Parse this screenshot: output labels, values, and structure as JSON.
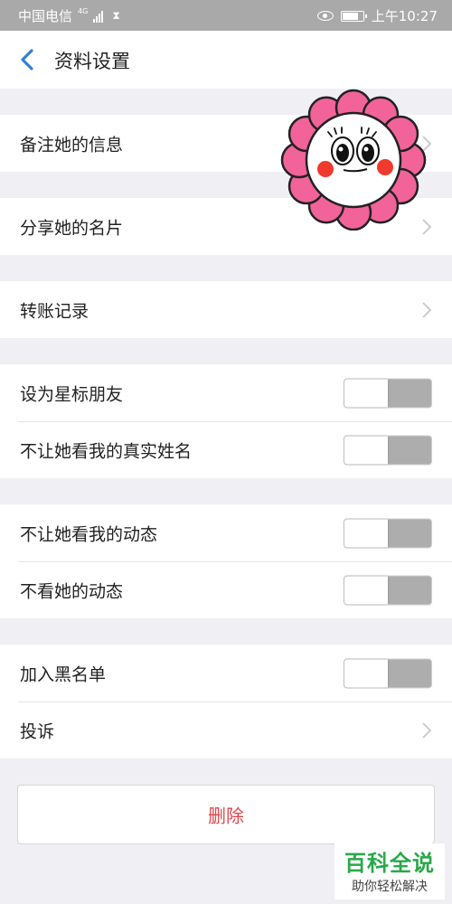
{
  "status_bar": {
    "carrier": "中国电信",
    "network": "4G",
    "time": "上午10:27",
    "battery_level": 0.8,
    "icons": [
      "signal-icon",
      "hourglass-icon",
      "eye-icon",
      "battery-icon"
    ]
  },
  "header": {
    "title": "资料设置",
    "back_icon": "chevron-left-icon"
  },
  "settings": {
    "remark": {
      "label": "备注她的信息"
    },
    "share_card": {
      "label": "分享她的名片"
    },
    "transfer_records": {
      "label": "转账记录"
    },
    "star_friend": {
      "label": "设为星标朋友",
      "enabled": false
    },
    "hide_real_name": {
      "label": "不让她看我的真实姓名",
      "enabled": false
    },
    "hide_my_moments": {
      "label": "不让她看我的动态",
      "enabled": false
    },
    "hide_her_moments": {
      "label": "不看她的动态",
      "enabled": false
    },
    "blacklist": {
      "label": "加入黑名单",
      "enabled": false
    },
    "report": {
      "label": "投诉"
    }
  },
  "delete_button": {
    "label": "删除"
  },
  "sticker": {
    "icon": "flower-face-sticker"
  },
  "watermark": {
    "title": "百科全说",
    "subtitle": "助你轻松解决"
  },
  "colors": {
    "accent": "#2f82d6",
    "danger": "#e0464d",
    "toggle_off": "#adadad",
    "status_bar": "#a9a9a9",
    "background": "#efeff4",
    "watermark_green": "#2aa84a"
  }
}
